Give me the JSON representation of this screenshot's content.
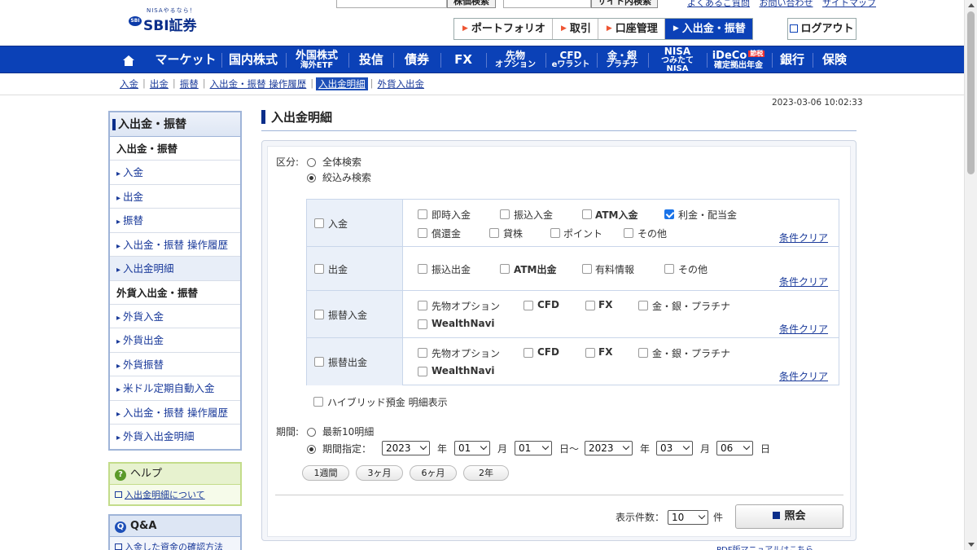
{
  "header": {
    "logo_tagline": "NISAやるなら！",
    "logo_name": "SBI証券",
    "search_btn1": "株価検索",
    "search_btn2": "サイト内検索",
    "top_links": [
      "よくあるご質問",
      "お問い合わせ",
      "サイトマップ"
    ],
    "nav": [
      "ポートフォリオ",
      "取引",
      "口座管理",
      "入出金・振替"
    ],
    "nav_active_index": 3,
    "logout": "ログアウト"
  },
  "mainnav": {
    "items": [
      {
        "l1": "マーケット"
      },
      {
        "l1": "国内株式"
      },
      {
        "l1": "外国株式",
        "l2": "海外ETF"
      },
      {
        "l1": "投信"
      },
      {
        "l1": "債券"
      },
      {
        "l1": "FX"
      },
      {
        "l1": "先物",
        "l2": "オプション"
      },
      {
        "l1": "CFD",
        "l2": "eワラント"
      },
      {
        "l1": "金・銀",
        "l2": "プラチナ"
      },
      {
        "l1": "NISA",
        "l2": "つみたてNISA"
      },
      {
        "l1": "iDeCo",
        "l2": "確定拠出年金",
        "badge": "節税"
      },
      {
        "l1": "銀行"
      },
      {
        "l1": "保険"
      }
    ]
  },
  "subnav": [
    "入金",
    "出金",
    "振替",
    "入出金・振替 操作履歴",
    "入出金明細",
    "外貨入出金"
  ],
  "subnav_active": 4,
  "timestamp": "2023-03-06 10:02:33",
  "sidebar": {
    "title": "入出金・振替",
    "section1": "入出金・振替",
    "links1": [
      "入金",
      "出金",
      "振替",
      "入出金・振替 操作履歴",
      "入出金明細"
    ],
    "section2": "外貨入出金・振替",
    "links2": [
      "外貨入金",
      "外貨出金",
      "外貨振替",
      "米ドル定期自動入金",
      "入出金・振替 操作履歴",
      "外貨入出金明細"
    ],
    "help_title": "ヘルプ",
    "help_link": "入出金明細について",
    "qa_title": "Q&A",
    "qa_link": "入金した資金の確認方法"
  },
  "page_title": "入出金明細",
  "form": {
    "kubun_label": "区分:",
    "radio_all": "全体検索",
    "radio_filter": "絞込み検索",
    "clear": "条件クリア",
    "rows": [
      {
        "head": "入金",
        "opts": [
          "即時入金",
          "振込入金",
          "ATM入金",
          "利金・配当金",
          "償還金",
          "貸株",
          "ポイント",
          "その他"
        ],
        "checked": [
          3
        ]
      },
      {
        "head": "出金",
        "opts": [
          "振込出金",
          "ATM出金",
          "有料情報",
          "その他"
        ],
        "checked": []
      },
      {
        "head": "振替入金",
        "opts": [
          "先物オプション",
          "CFD",
          "FX",
          "金・銀・プラチナ",
          "WealthNavi"
        ],
        "checked": []
      },
      {
        "head": "振替出金",
        "opts": [
          "先物オプション",
          "CFD",
          "FX",
          "金・銀・プラチナ",
          "WealthNavi"
        ],
        "checked": []
      }
    ],
    "hybrid": "ハイブリッド預金 明細表示",
    "period_label": "期間:",
    "radio_latest": "最新10明細",
    "radio_period": "期間指定：",
    "from": {
      "year": "2023",
      "month": "01",
      "day": "01"
    },
    "to": {
      "year": "2023",
      "month": "03",
      "day": "06"
    },
    "unit_year": "年",
    "unit_month": "月",
    "unit_day": "日",
    "tilde": "日〜",
    "quick": [
      "1週間",
      "3ヶ月",
      "6ヶ月",
      "2年"
    ],
    "count_label": "表示件数：",
    "count_value": "10",
    "count_unit": "件",
    "submit": "照会"
  },
  "bottom_text": "PDF版マニュアルはこちら"
}
